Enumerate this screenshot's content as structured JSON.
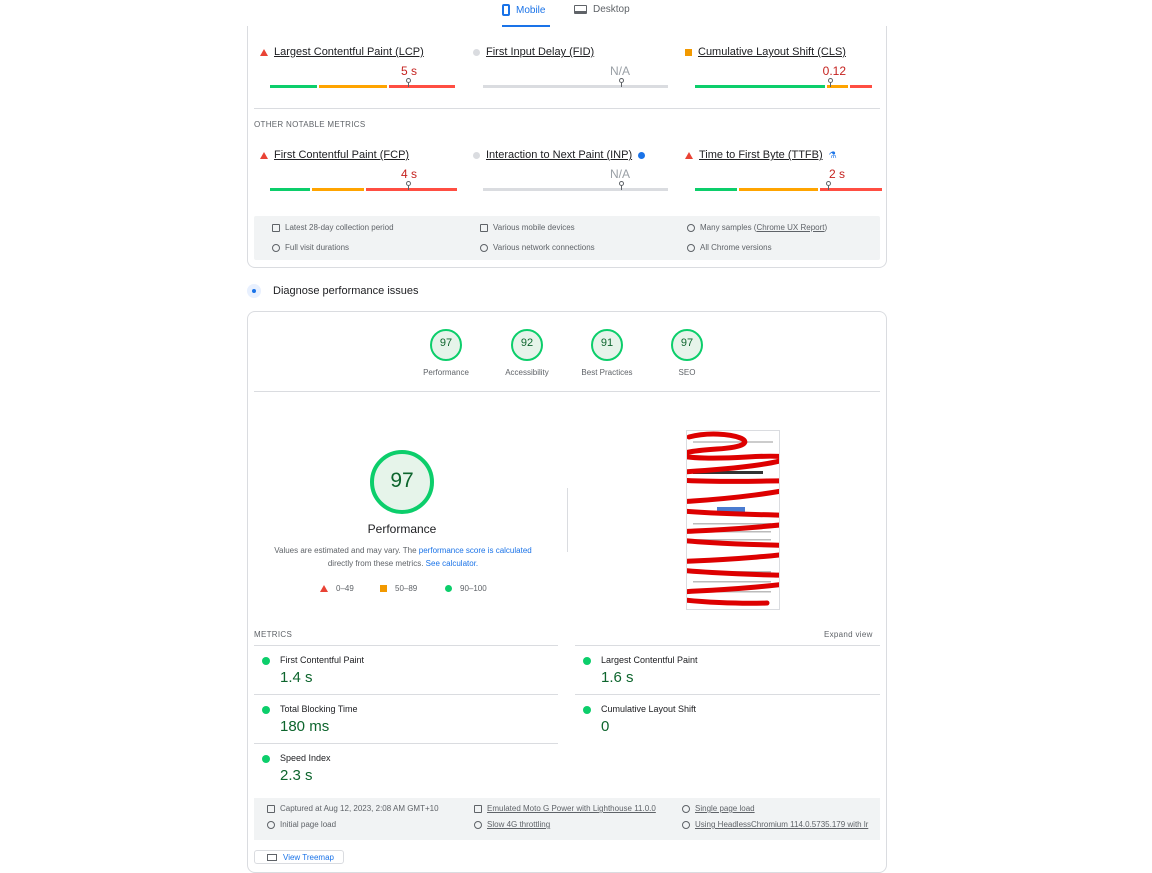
{
  "tabs": {
    "mobile": "Mobile",
    "desktop": "Desktop"
  },
  "field": {
    "core": [
      {
        "name": "Largest Contentful Paint (LCP)",
        "value": "5 s",
        "status": "poor"
      },
      {
        "name": "First Input Delay (FID)",
        "value": "N/A",
        "status": "na"
      },
      {
        "name": "Cumulative Layout Shift (CLS)",
        "value": "0.12",
        "status": "average"
      }
    ],
    "other_label": "OTHER NOTABLE METRICS",
    "other": [
      {
        "name": "First Contentful Paint (FCP)",
        "value": "4 s",
        "status": "poor"
      },
      {
        "name": "Interaction to Next Paint (INP)",
        "value": "N/A",
        "status": "na"
      },
      {
        "name": "Time to First Byte (TTFB)",
        "value": "2 s",
        "status": "poor"
      }
    ],
    "info": {
      "period": "Latest 28-day collection period",
      "devices": "Various mobile devices",
      "samples_prefix": "Many samples (",
      "samples_link": "Chrome UX Report",
      "samples_suffix": ")",
      "durations": "Full visit durations",
      "network": "Various network connections",
      "chrome": "All Chrome versions"
    }
  },
  "diagnose": {
    "title": "Diagnose performance issues"
  },
  "scores": [
    {
      "value": "97",
      "label": "Performance"
    },
    {
      "value": "92",
      "label": "Accessibility"
    },
    {
      "value": "91",
      "label": "Best Practices"
    },
    {
      "value": "97",
      "label": "SEO"
    }
  ],
  "main_score": {
    "value": "97",
    "label": "Performance",
    "note_1": "Values are estimated and may vary. The ",
    "note_link": "performance score is calculated",
    "note_2": "directly from these metrics. ",
    "note_calc": "See calculator.",
    "legend": [
      "0–49",
      "50–89",
      "90–100"
    ]
  },
  "lab": {
    "label": "METRICS",
    "expand": "Expand view",
    "metrics": [
      {
        "name": "First Contentful Paint",
        "value": "1.4 s"
      },
      {
        "name": "Largest Contentful Paint",
        "value": "1.6 s"
      },
      {
        "name": "Total Blocking Time",
        "value": "180 ms"
      },
      {
        "name": "Cumulative Layout Shift",
        "value": "0"
      },
      {
        "name": "Speed Index",
        "value": "2.3 s"
      }
    ]
  },
  "footer": {
    "captured": "Captured at Aug 12, 2023, 2:08 AM GMT+10",
    "device": "Emulated Moto G Power with Lighthouse 11.0.0",
    "session": "Single page load",
    "initial": "Initial page load",
    "throttle": "Slow 4G throttling",
    "browser": "Using HeadlessChromium 114.0.5735.179 with lr",
    "treemap": "View Treemap"
  },
  "colors": {
    "good": "#0cce6b",
    "average": "#ffa400",
    "poor": "#ff4e42",
    "accent": "#1a73e8"
  }
}
